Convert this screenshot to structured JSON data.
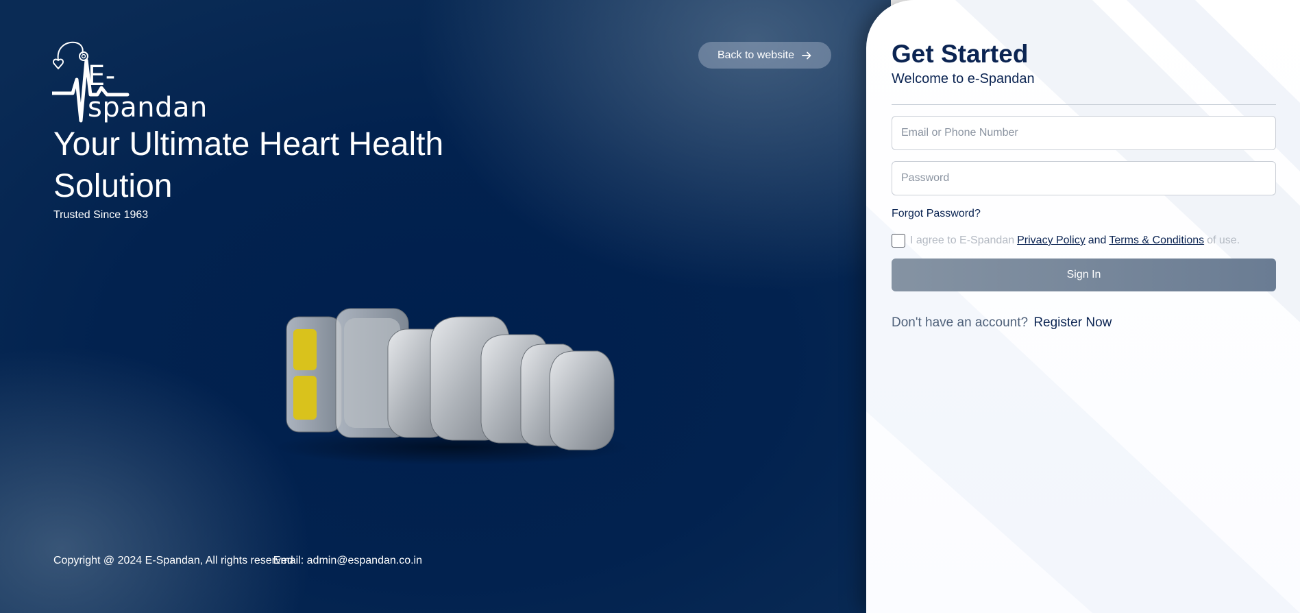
{
  "brand": {
    "logo_text": "E-spandan",
    "logo_icon": "heart-stethoscope-ecg-icon"
  },
  "hero": {
    "headline": "Your Ultimate Heart Health Solution",
    "subline": "Trusted Since 1963",
    "back_button_label": "Back to website",
    "back_button_icon": "arrow-right-icon",
    "image_description_icon": "pacemaker-devices-image"
  },
  "footer": {
    "copyright": "Copyright @ 2024 E-Spandan, All rights reserved",
    "email": "Email: admin@espandan.co.in"
  },
  "login": {
    "title": "Get Started",
    "welcome": "Welcome to e-Spandan",
    "email_placeholder": "Email or Phone Number",
    "password_placeholder": "Password",
    "forgot_password": "Forgot Password?",
    "agree_prefix": "I agree to E-Spandan",
    "privacy_policy": "Privacy Policy",
    "and": "and",
    "terms": "Terms & Conditions",
    "agree_suffix": "of use.",
    "sign_in_label": "Sign In",
    "no_account": "Don't have an account?",
    "register": "Register Now"
  },
  "colors": {
    "hero_bg": "#02224f",
    "primary_text": "#0b2452",
    "sign_in_bg": "#7a8a9c",
    "muted_text": "#b3b9c2"
  }
}
